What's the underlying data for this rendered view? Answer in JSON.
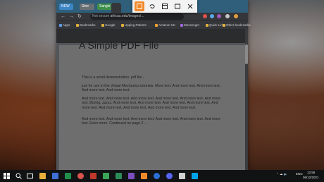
{
  "browser": {
    "tabs": [
      {
        "label": "NEW",
        "color": "#3d86c6"
      },
      {
        "label": "Sine",
        "color": "#6b6f74"
      },
      {
        "label": "Sangle",
        "color": "#3f8f4a"
      }
    ],
    "address": {
      "secure_label": "Not secure",
      "url": "africau.edu/images/..."
    },
    "bookmarks": [
      "Apps",
      "Bookmarks",
      "Google",
      "Upping Patents",
      "Amazon UK",
      "Messenger",
      "Quick Links",
      "Other bookmarks"
    ]
  },
  "pdf": {
    "title": "A Simple PDF File",
    "paragraphs": [
      "This is a small demonstration .pdf file -",
      "just for use in the Virtual Mechanics tutorials. More text. And more text. And more text. And more text. And more text.",
      "And more text. And more text. And more text. And more text. And more text. And more text. Boring, zzzzz. And more text. And more text. And more text. And more text. And more text. And more text. And more text. And more text. And more text.",
      "And more text. And more text. And more text. And more text. And more text. And more text. Even more. Continued on page 2 ..."
    ]
  },
  "snip": {
    "modes": [
      "rectangular-snip",
      "freeform-snip",
      "window-snip",
      "fullscreen-snip",
      "close"
    ]
  },
  "taskbar": {
    "tray_lang": "ENG",
    "time": "12:58",
    "date": "06/12/2021"
  },
  "colors": {
    "snip_accent": "#f28a2b",
    "taskbar": "#101214"
  }
}
